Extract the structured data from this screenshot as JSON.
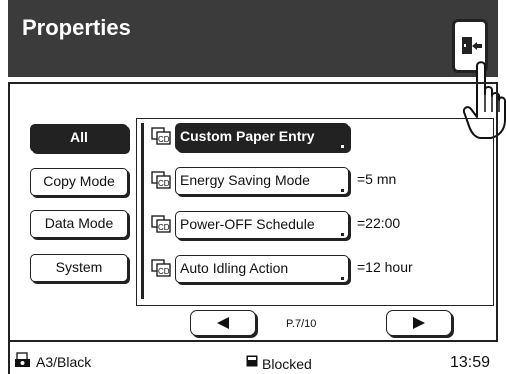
{
  "header": {
    "title": "Properties",
    "exit_icon": "exit-door-icon"
  },
  "categories": [
    {
      "label": "All",
      "active": true
    },
    {
      "label": "Copy Mode",
      "active": false
    },
    {
      "label": "Data Mode",
      "active": false
    },
    {
      "label": "System",
      "active": false
    }
  ],
  "settings": [
    {
      "label": "Custom Paper Entry",
      "value": "",
      "icon": "copy-data-icon",
      "highlighted": true
    },
    {
      "label": "Energy Saving Mode",
      "value": "=5 mn",
      "icon": "copy-data-icon",
      "highlighted": false
    },
    {
      "label": "Power-OFF Schedule",
      "value": "=22:00",
      "icon": "copy-data-icon",
      "highlighted": false
    },
    {
      "label": "Auto Idling Action",
      "value": "=12 hour",
      "icon": "copy-data-icon",
      "highlighted": false
    }
  ],
  "pagination": {
    "page": "P.7/10",
    "prev_icon": "triangle-left-icon",
    "next_icon": "triangle-right-icon"
  },
  "status": {
    "paper": "A3/Black",
    "state": "Blocked",
    "time": "13:59"
  },
  "colors": {
    "header_bg": "#3b3b3b",
    "active_bg": "#222222"
  }
}
